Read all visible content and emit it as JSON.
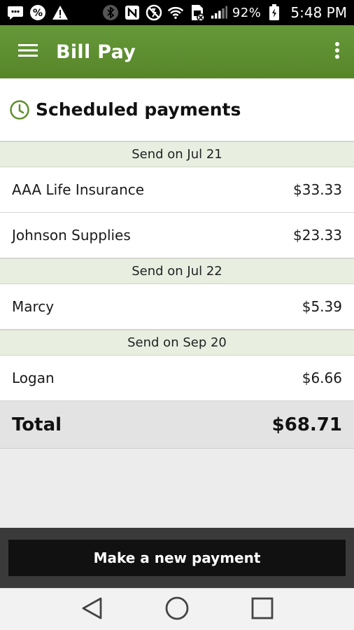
{
  "status_bar": {
    "battery_percent": "92%",
    "time": "5:48 PM",
    "icons": [
      "messages-icon",
      "percent-icon",
      "warning-icon",
      "bluetooth-icon",
      "nfc-icon",
      "mute-icon",
      "wifi-icon",
      "sim-icon",
      "signal-icon",
      "battery-icon"
    ]
  },
  "app_bar": {
    "title": "Bill Pay",
    "menu_icon": "hamburger-menu-icon",
    "overflow_icon": "more-vert-icon"
  },
  "section": {
    "title": "Scheduled payments",
    "icon": "clock-icon",
    "accent_color": "#5f8f2d"
  },
  "groups": [
    {
      "date_label": "Send on Jul 21",
      "payments": [
        {
          "payee": "AAA Life Insurance",
          "amount": "$33.33"
        },
        {
          "payee": "Johnson Supplies",
          "amount": "$23.33"
        }
      ]
    },
    {
      "date_label": "Send on Jul 22",
      "payments": [
        {
          "payee": "Marcy",
          "amount": "$5.39"
        }
      ]
    },
    {
      "date_label": "Send on Sep 20",
      "payments": [
        {
          "payee": "Logan",
          "amount": "$6.66"
        }
      ]
    }
  ],
  "total": {
    "label": "Total",
    "amount": "$68.71"
  },
  "footer": {
    "button_label": "Make a new payment"
  },
  "nav_bar": {
    "icons": [
      "back-icon",
      "home-icon",
      "recents-icon"
    ]
  }
}
